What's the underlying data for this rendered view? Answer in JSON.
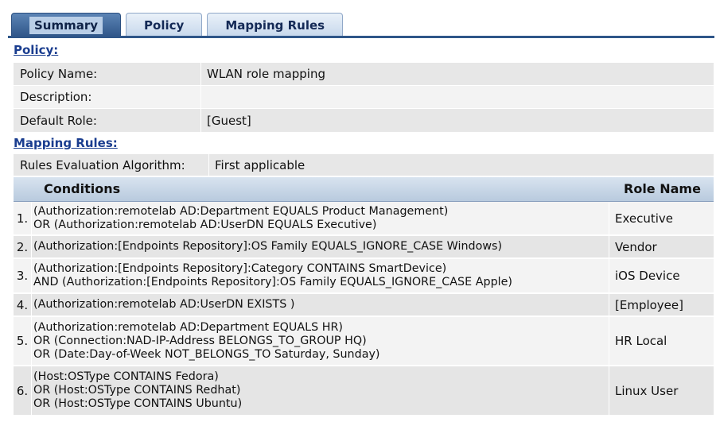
{
  "tabs": [
    {
      "label": "Summary",
      "active": true
    },
    {
      "label": "Policy",
      "active": false
    },
    {
      "label": "Mapping Rules",
      "active": false
    }
  ],
  "policy_section": {
    "title": "Policy:",
    "rows": [
      {
        "label": "Policy Name:",
        "value": "WLAN role mapping"
      },
      {
        "label": "Description:",
        "value": ""
      },
      {
        "label": "Default Role:",
        "value": "[Guest]"
      }
    ]
  },
  "mapping_section": {
    "title": "Mapping Rules:",
    "algorithm_label": "Rules Evaluation Algorithm:",
    "algorithm_value": "First applicable",
    "headers": {
      "conditions": "Conditions",
      "role_name": "Role Name"
    },
    "rules": [
      {
        "num": "1.",
        "lines": [
          "(Authorization:remotelab AD:Department EQUALS Product Management)",
          "OR (Authorization:remotelab AD:UserDN EQUALS Executive)"
        ],
        "role": "Executive"
      },
      {
        "num": "2.",
        "lines": [
          "(Authorization:[Endpoints Repository]:OS Family EQUALS_IGNORE_CASE Windows)"
        ],
        "role": "Vendor"
      },
      {
        "num": "3.",
        "lines": [
          "(Authorization:[Endpoints Repository]:Category CONTAINS SmartDevice)",
          "AND (Authorization:[Endpoints Repository]:OS Family EQUALS_IGNORE_CASE Apple)"
        ],
        "role": "iOS Device"
      },
      {
        "num": "4.",
        "lines": [
          "(Authorization:remotelab AD:UserDN EXISTS )"
        ],
        "role": "[Employee]"
      },
      {
        "num": "5.",
        "lines": [
          "(Authorization:remotelab AD:Department EQUALS HR)",
          "OR (Connection:NAD-IP-Address BELONGS_TO_GROUP HQ)",
          "OR (Date:Day-of-Week NOT_BELONGS_TO Saturday, Sunday)"
        ],
        "role": "HR Local"
      },
      {
        "num": "6.",
        "lines": [
          "(Host:OSType CONTAINS Fedora)",
          "OR (Host:OSType CONTAINS Redhat)",
          "OR (Host:OSType CONTAINS Ubuntu)"
        ],
        "role": "Linux User"
      }
    ]
  }
}
